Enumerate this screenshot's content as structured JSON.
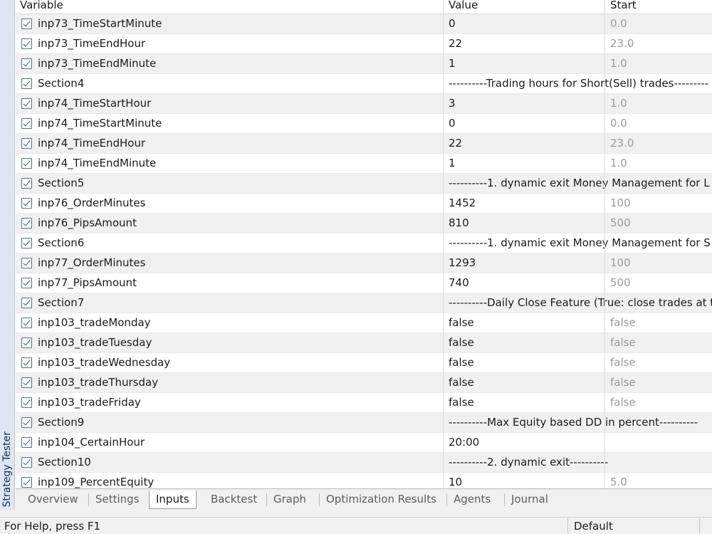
{
  "side_panel": {
    "label": "Strategy Tester"
  },
  "columns": {
    "variable": "Variable",
    "value": "Value",
    "start": "Start"
  },
  "rows": [
    {
      "variable": "inp73_TimeStartMinute",
      "value": "0",
      "start": "0.0"
    },
    {
      "variable": "inp73_TimeEndHour",
      "value": "22",
      "start": "23.0"
    },
    {
      "variable": "inp73_TimeEndMinute",
      "value": "1",
      "start": "1.0"
    },
    {
      "variable": "Section4",
      "value": "----------Trading hours for Short(Sell) trades---------",
      "start": ""
    },
    {
      "variable": "inp74_TimeStartHour",
      "value": "3",
      "start": "1.0"
    },
    {
      "variable": "inp74_TimeStartMinute",
      "value": "0",
      "start": "0.0"
    },
    {
      "variable": "inp74_TimeEndHour",
      "value": "22",
      "start": "23.0"
    },
    {
      "variable": "inp74_TimeEndMinute",
      "value": "1",
      "start": "1.0"
    },
    {
      "variable": "Section5",
      "value": "----------1. dynamic exit Money Management for L",
      "start": ""
    },
    {
      "variable": "inp76_OrderMinutes",
      "value": "1452",
      "start": "100"
    },
    {
      "variable": "inp76_PipsAmount",
      "value": "810",
      "start": "500"
    },
    {
      "variable": "Section6",
      "value": "----------1. dynamic exit Money Management for S",
      "start": ""
    },
    {
      "variable": "inp77_OrderMinutes",
      "value": "1293",
      "start": "100"
    },
    {
      "variable": "inp77_PipsAmount",
      "value": "740",
      "start": "500"
    },
    {
      "variable": "Section7",
      "value": "----------Daily Close Feature (True: close trades at t",
      "start": ""
    },
    {
      "variable": "inp103_tradeMonday",
      "value": "false",
      "start": "false"
    },
    {
      "variable": "inp103_tradeTuesday",
      "value": "false",
      "start": "false"
    },
    {
      "variable": "inp103_tradeWednesday",
      "value": "false",
      "start": "false"
    },
    {
      "variable": "inp103_tradeThursday",
      "value": "false",
      "start": "false"
    },
    {
      "variable": "inp103_tradeFriday",
      "value": "false",
      "start": "false"
    },
    {
      "variable": "Section9",
      "value": "----------Max Equity based DD in percent----------",
      "start": ""
    },
    {
      "variable": "inp104_CertainHour",
      "value": "20:00",
      "start": ""
    },
    {
      "variable": "Section10",
      "value": "----------2. dynamic exit----------",
      "start": ""
    },
    {
      "variable": "inp109_PercentEquity",
      "value": "10",
      "start": "5.0"
    }
  ],
  "tabs": [
    {
      "label": "Overview",
      "active": false
    },
    {
      "label": "Settings",
      "active": false
    },
    {
      "label": "Inputs",
      "active": true
    },
    {
      "label": "Backtest",
      "active": false
    },
    {
      "label": "Graph",
      "active": false
    },
    {
      "label": "Optimization Results",
      "active": false
    },
    {
      "label": "Agents",
      "active": false
    },
    {
      "label": "Journal",
      "active": false
    }
  ],
  "status_bar": {
    "help": "For Help, press F1",
    "profile": "Default"
  },
  "colors": {
    "stripe": "#f0f0f0",
    "checkbox": "#3a5a86",
    "start_text": "#9a9a9a",
    "side_panel": "#dde6f2"
  }
}
